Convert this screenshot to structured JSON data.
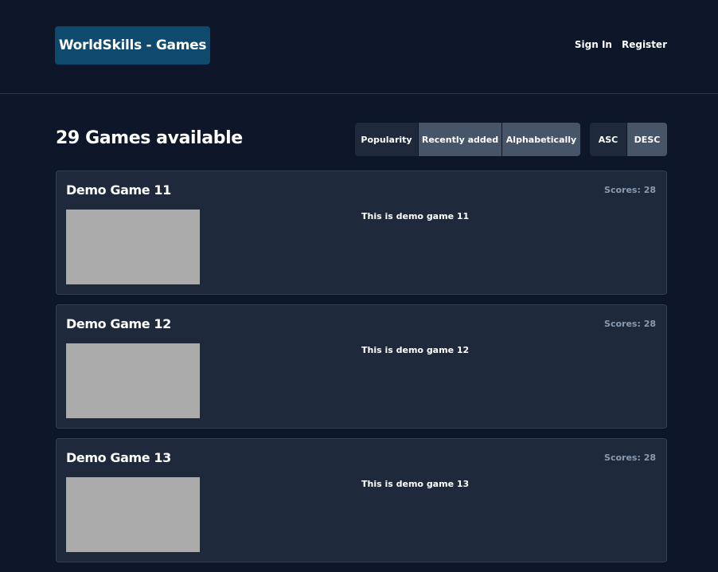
{
  "header": {
    "brand": "WorldSkills - Games",
    "nav": {
      "sign_in": "Sign In",
      "register": "Register"
    }
  },
  "toolbar": {
    "count_title": "29 Games available",
    "sort_options": [
      {
        "label": "Popularity",
        "selected": true
      },
      {
        "label": "Recently added",
        "selected": false
      },
      {
        "label": "Alphabetically",
        "selected": false
      }
    ],
    "direction_options": [
      {
        "label": "ASC",
        "selected": true
      },
      {
        "label": "DESC",
        "selected": false
      }
    ]
  },
  "games": [
    {
      "title": "Demo Game 11",
      "scores": "Scores: 28",
      "description": "This is demo game 11"
    },
    {
      "title": "Demo Game 12",
      "scores": "Scores: 28",
      "description": "This is demo game 12"
    },
    {
      "title": "Demo Game 13",
      "scores": "Scores: 28",
      "description": "This is demo game 13"
    }
  ],
  "colors": {
    "background": "#0e1729",
    "brand_bg": "#0d4a6e",
    "card_bg": "#1e293b",
    "card_border": "#334155",
    "button_selected": "#1e293b",
    "button_unselected": "#475569",
    "score_text": "#8a9bb2",
    "thumbnail_placeholder": "#ababab"
  }
}
